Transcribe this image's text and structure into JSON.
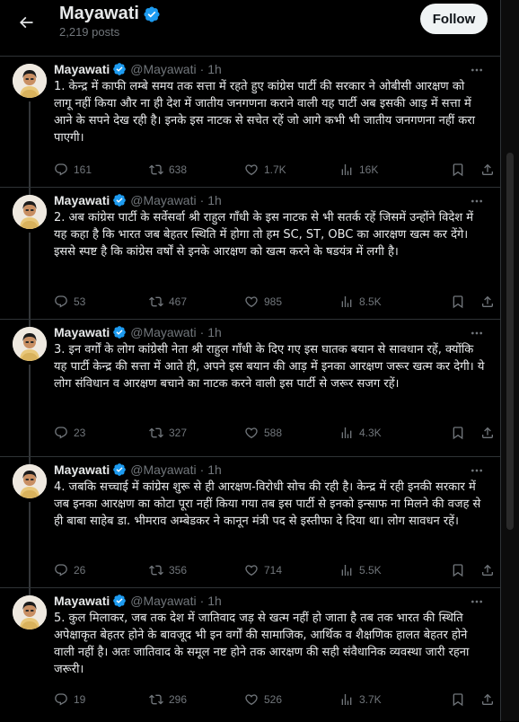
{
  "header": {
    "back_label": "←",
    "name": "Mayawati",
    "posts_count": "2,219 posts",
    "follow_label": "Follow"
  },
  "tweets": [
    {
      "name": "Mayawati",
      "handle": "@Mayawati",
      "separator": "·",
      "time": "1h",
      "text": "1. केन्द्र में काफी लम्बे समय तक सत्ता में रहते हुए कांग्रेस पार्टी की सरकार ने ओबीसी आरक्षण को लागू नहीं किया और ना ही देश में जातीय जनगणना कराने वाली यह पार्टी अब इसकी आड़ में सत्ता में आने के सपने देख रही है। इनके इस नाटक से सचेत रहें जो आगे कभी भी जातीय जनगणना नहीं करा पाएगी।",
      "replies": "161",
      "reposts": "638",
      "likes": "1.7K",
      "views": "16K"
    },
    {
      "name": "Mayawati",
      "handle": "@Mayawati",
      "separator": "·",
      "time": "1h",
      "text": "2. अब कांग्रेस पार्टी के सर्वेसर्वा श्री राहुल गाँधी के इस नाटक से भी सतर्क रहें जिसमें उन्होंने विदेश में यह कहा है कि भारत जब बेहतर स्थिति में होगा तो हम SC, ST, OBC का आरक्षण खत्म कर देंगे। इससे स्पष्ट है कि कांग्रेस वर्षों से इनके आरक्षण को खत्म करने के षडयंत्र में लगी है।",
      "replies": "53",
      "reposts": "467",
      "likes": "985",
      "views": "8.5K"
    },
    {
      "name": "Mayawati",
      "handle": "@Mayawati",
      "separator": "·",
      "time": "1h",
      "text": "3. इन वर्गों के लोग कांग्रेसी नेता श्री राहुल गाँधी के दिए गए इस घातक बयान से सावधान रहें, क्योंकि यह पार्टी केन्द्र की सत्ता में आते ही, अपने इस बयान की आड़ में इनका आरक्षण जरूर खत्म कर देगी। ये लोग संविधान व आरक्षण बचाने का नाटक करने वाली इस पार्टी से जरूर सजग रहें।",
      "replies": "23",
      "reposts": "327",
      "likes": "588",
      "views": "4.3K"
    },
    {
      "name": "Mayawati",
      "handle": "@Mayawati",
      "separator": "·",
      "time": "1h",
      "text": "4. जबकि सच्चाई में कांग्रेस शुरू से ही आरक्षण-विरोधी सोच की रही है। केन्द्र में रही इनकी सरकार में जब इनका आरक्षण का कोटा पूरा नहीं किया गया तब इस पार्टी से इनको इन्साफ ना मिलने की वजह से ही बाबा साहेब डा. भीमराव अम्बेडकर ने कानून मंत्री पद से इस्तीफा दे दिया था। लोग सावधन रहें।",
      "replies": "26",
      "reposts": "356",
      "likes": "714",
      "views": "5.5K"
    },
    {
      "name": "Mayawati",
      "handle": "@Mayawati",
      "separator": "·",
      "time": "1h",
      "text": "5. कुल मिलाकर, जब तक देश में जातिवाद जड़ से खत्म नहीं हो जाता है तब तक भारत की स्थिति अपेक्षाकृत बेहतर होने के बावजूद भी इन वर्गों की सामाजिक, आर्थिक व शैक्षणिक हालत बेहतर होने वाली नहीं है। अतः जातिवाद के समूल नष्ट होने तक आरक्षण की सही संवैधानिक व्यवस्था जारी रहना जरूरी।",
      "replies": "19",
      "reposts": "296",
      "likes": "526",
      "views": "3.7K"
    }
  ],
  "icons": {
    "back": "arrow-left-icon",
    "verified": "verified-badge-icon",
    "more": "more-dots-icon",
    "reply": "reply-icon",
    "repost": "repost-icon",
    "like": "heart-icon",
    "views": "views-chart-icon",
    "bookmark": "bookmark-icon",
    "share": "share-icon"
  },
  "colors": {
    "background": "#000000",
    "text": "#e7e9ea",
    "muted": "#71767b",
    "verified": "#1d9bf0",
    "follow_bg": "#eff3f4"
  }
}
